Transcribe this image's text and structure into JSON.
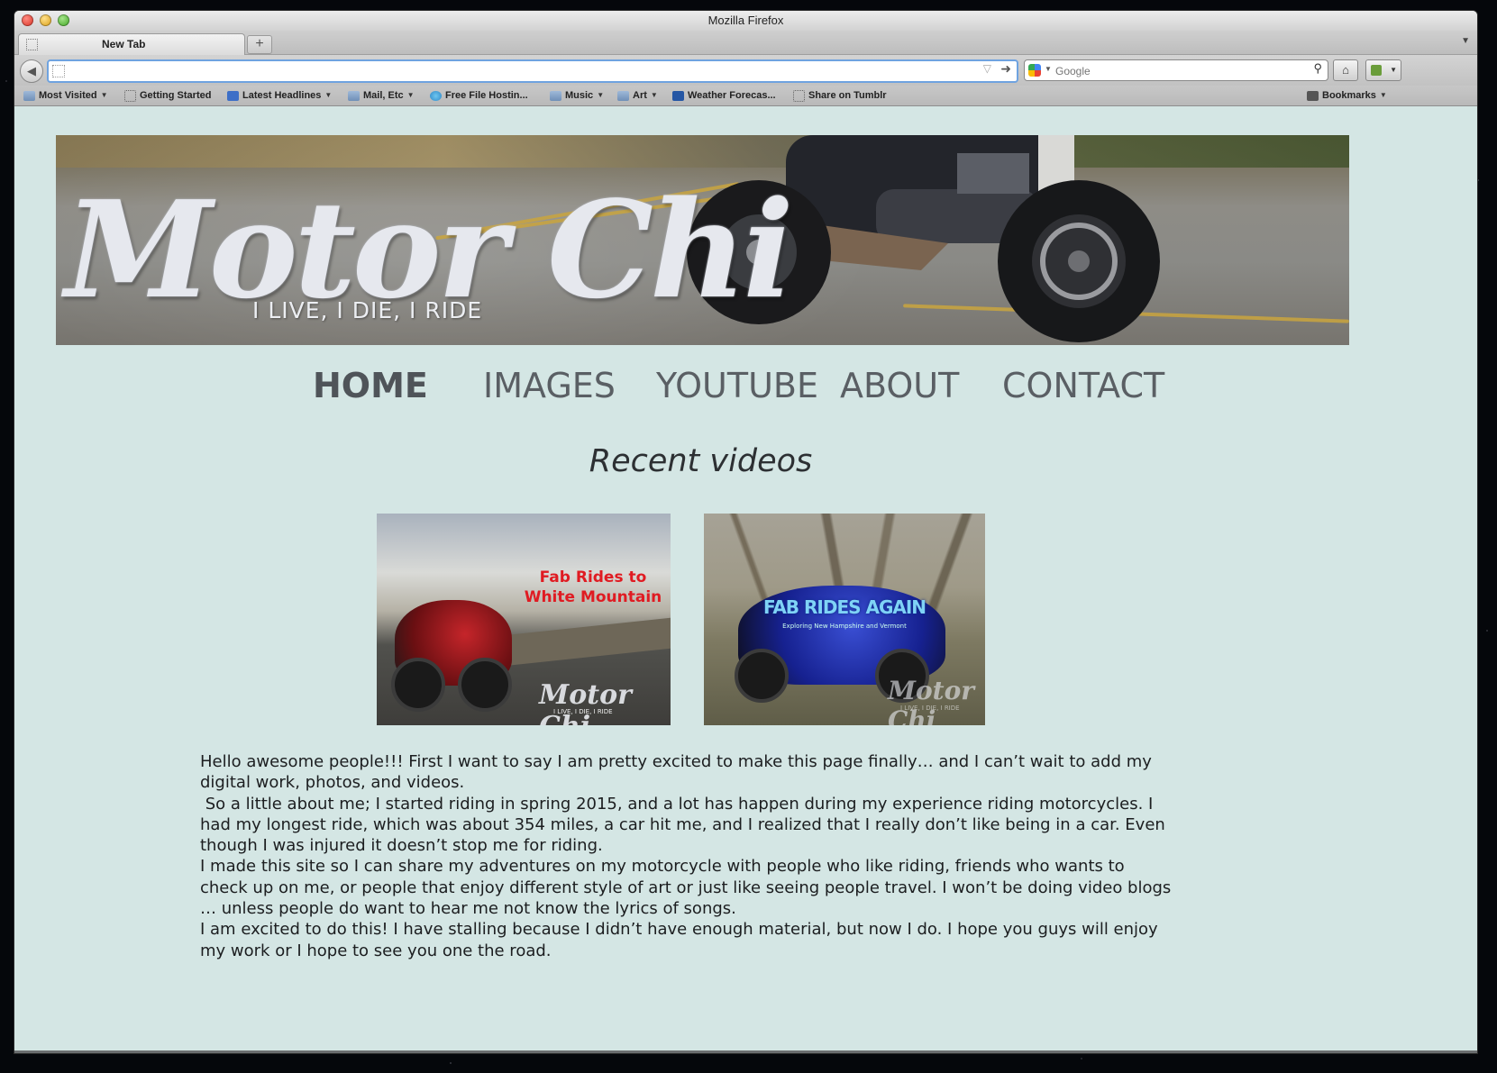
{
  "browser": {
    "window_title": "Mozilla Firefox",
    "tab_label": "New Tab",
    "new_tab_symbol": "+",
    "url_value": "",
    "search_placeholder": "Google",
    "home_icon": "home-icon",
    "bookmarks_bar": [
      {
        "label": "Most Visited",
        "icon": "folder-icon",
        "has_menu": true
      },
      {
        "label": "Getting Started",
        "icon": "page-icon",
        "has_menu": false
      },
      {
        "label": "Latest Headlines",
        "icon": "rss-icon",
        "has_menu": true
      },
      {
        "label": "Mail, Etc",
        "icon": "folder-icon",
        "has_menu": true
      },
      {
        "label": "Free File Hostin...",
        "icon": "cloud-icon",
        "has_menu": false
      },
      {
        "label": "Music",
        "icon": "folder-icon",
        "has_menu": true
      },
      {
        "label": "Art",
        "icon": "folder-icon",
        "has_menu": true
      },
      {
        "label": "Weather Forecas...",
        "icon": "weather-icon",
        "has_menu": false
      },
      {
        "label": "Share on Tumblr",
        "icon": "page-icon",
        "has_menu": false
      }
    ],
    "bookmarks_menu_label": "Bookmarks"
  },
  "site": {
    "banner": {
      "logo_text": "Motor Chi",
      "tagline": "I LIVE, I DIE, I RIDE"
    },
    "nav": [
      {
        "label": "HOME",
        "active": true
      },
      {
        "label": "IMAGES",
        "active": false
      },
      {
        "label": "YOUTUBE",
        "active": false
      },
      {
        "label": "ABOUT",
        "active": false
      },
      {
        "label": "CONTACT",
        "active": false
      }
    ],
    "section_title": "Recent videos",
    "videos": [
      {
        "title": "Fab Rides to White Mountain",
        "watermark": "Motor Chi",
        "watermark_tag": "I LIVE, I DIE, I RIDE"
      },
      {
        "title": "FAB RIDES AGAIN",
        "subtitle": "Exploring New Hampshire and Vermont",
        "watermark": "Motor Chi",
        "watermark_tag": "I LIVE, I DIE, I RIDE"
      }
    ],
    "body_paragraphs": [
      "Hello awesome people!!! First I want to say I am pretty excited to make this page finally… and I can’t wait to add my digital work, photos, and videos.",
      " So a little about me; I started riding in spring 2015, and a lot has happen during my experience riding motorcycles. I had my longest ride, which was about 354 miles, a car hit me, and I realized that I really don’t like being in a car. Even though I was injured it doesn’t stop me for riding.",
      "I made this site so I can share my adventures on my motorcycle with people who like riding, friends who wants to check up on me, or people that enjoy different style of art or just like seeing people travel.  I won’t be doing video blogs … unless people do want to hear me not know the lyrics of songs.",
      "I am excited to do this!  I have stalling because I didn’t have enough material, but now I do. I hope you guys will enjoy my work or I hope to see you one the road."
    ]
  },
  "colors": {
    "page_background": "#d4e6e4",
    "nav_text": "#5a5f64",
    "thumb_title_red": "#e01b22",
    "thumb_title_blue": "#7fd3f6"
  }
}
